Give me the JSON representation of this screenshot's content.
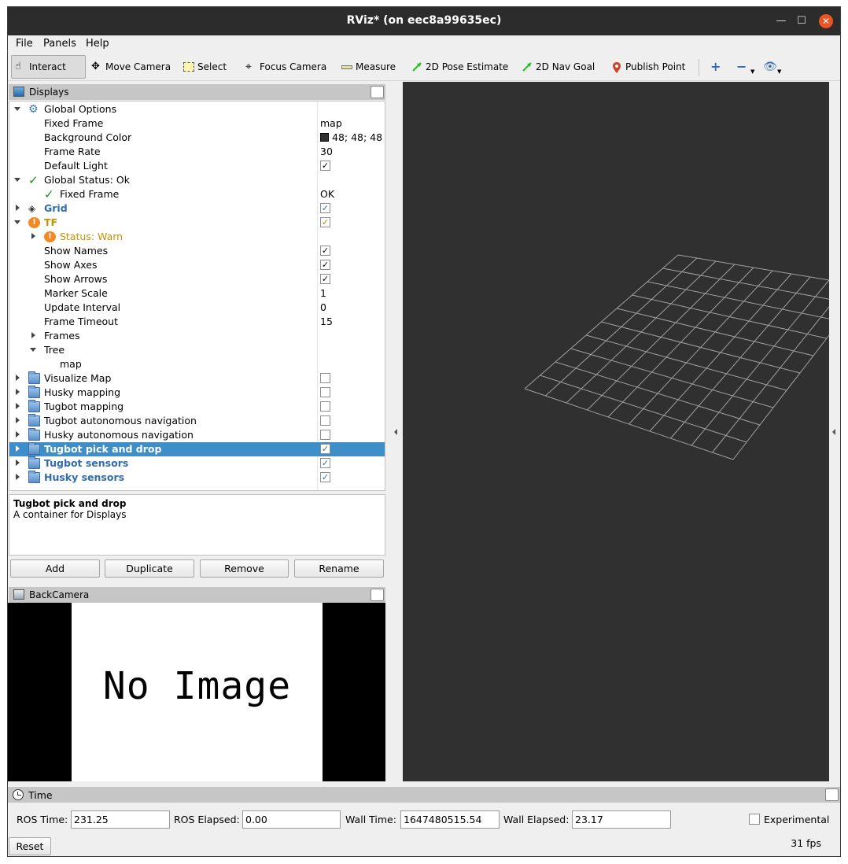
{
  "window": {
    "title": "RViz* (on eec8a99635ec)"
  },
  "menu": {
    "file": "File",
    "panels": "Panels",
    "help": "Help"
  },
  "toolbar": {
    "interact": "Interact",
    "move_camera": "Move Camera",
    "select": "Select",
    "focus_camera": "Focus Camera",
    "measure": "Measure",
    "pose_estimate": "2D Pose Estimate",
    "nav_goal": "2D Nav Goal",
    "publish_point": "Publish Point"
  },
  "displays": {
    "title": "Displays",
    "rows": {
      "global_options": "Global Options",
      "fixed_frame": "Fixed Frame",
      "fixed_frame_val": "map",
      "bg_color": "Background Color",
      "bg_color_val": "48; 48; 48",
      "frame_rate": "Frame Rate",
      "frame_rate_val": "30",
      "default_light": "Default Light",
      "global_status": "Global Status: Ok",
      "gs_fixed_frame": "Fixed Frame",
      "gs_fixed_frame_val": "OK",
      "grid": "Grid",
      "tf": "TF",
      "status_warn": "Status: Warn",
      "show_names": "Show Names",
      "show_axes": "Show Axes",
      "show_arrows": "Show Arrows",
      "marker_scale": "Marker Scale",
      "marker_scale_val": "1",
      "update_interval": "Update Interval",
      "update_interval_val": "0",
      "frame_timeout": "Frame Timeout",
      "frame_timeout_val": "15",
      "frames": "Frames",
      "tree": "Tree",
      "tree_map": "map",
      "visualize_map": "Visualize Map",
      "husky_mapping": "Husky mapping",
      "tugbot_mapping": "Tugbot mapping",
      "tugbot_nav": "Tugbot autonomous navigation",
      "husky_nav": "Husky autonomous navigation",
      "tugbot_pick": "Tugbot pick and drop",
      "tugbot_sensors": "Tugbot sensors",
      "husky_sensors": "Husky sensors"
    },
    "description": {
      "title": "Tugbot pick and drop",
      "text": "A container for Displays"
    },
    "buttons": {
      "add": "Add",
      "duplicate": "Duplicate",
      "remove": "Remove",
      "rename": "Rename"
    }
  },
  "camera": {
    "title": "BackCamera",
    "no_image": "No Image"
  },
  "time": {
    "title": "Time",
    "ros_time_label": "ROS Time:",
    "ros_time": "231.25",
    "ros_elapsed_label": "ROS Elapsed:",
    "ros_elapsed": "0.00",
    "wall_time_label": "Wall Time:",
    "wall_time": "1647480515.54",
    "wall_elapsed_label": "Wall Elapsed:",
    "wall_elapsed": "23.17",
    "experimental": "Experimental",
    "reset": "Reset",
    "fps": "31 fps"
  },
  "colors": {
    "view_bg": "#303030",
    "selection": "#3d8ec9",
    "display_blue": "#2f6cb2",
    "warn": "#f08a24"
  }
}
